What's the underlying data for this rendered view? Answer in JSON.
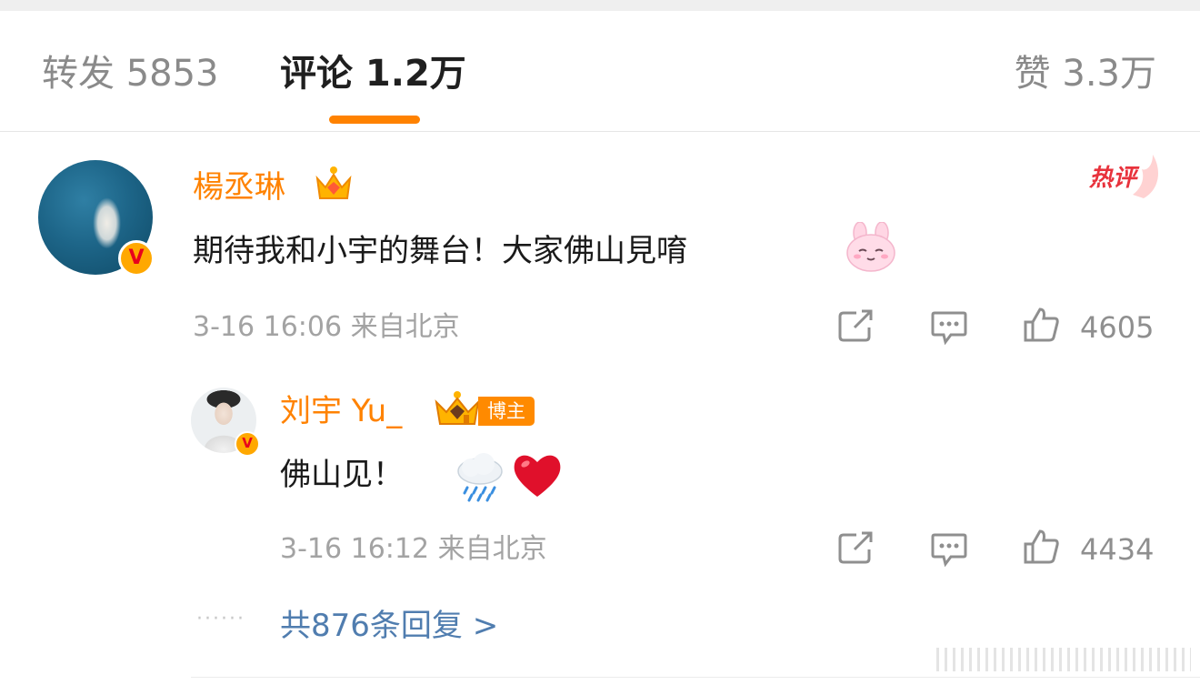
{
  "tabs": {
    "repost": "转发 5853",
    "comment": "评论 1.2万",
    "like": "赞 3.3万"
  },
  "comments": [
    {
      "user": "楊丞琳",
      "text": "期待我和小宇的舞台！大家佛山見唷",
      "meta": "3-16 16:06  来自北京",
      "likes": "4605",
      "hot_badge": "热评",
      "badge": "V"
    },
    {
      "user": "刘宇 Yu_",
      "blogger_tag": "博主",
      "text": "佛山见！",
      "meta": "3-16 16:12  来自北京",
      "likes": "4434",
      "badge": "V"
    }
  ],
  "more_replies": "共876条回复 >",
  "colors": {
    "accent": "#ff8200",
    "link": "#507daf",
    "hot": "#e8323c"
  }
}
